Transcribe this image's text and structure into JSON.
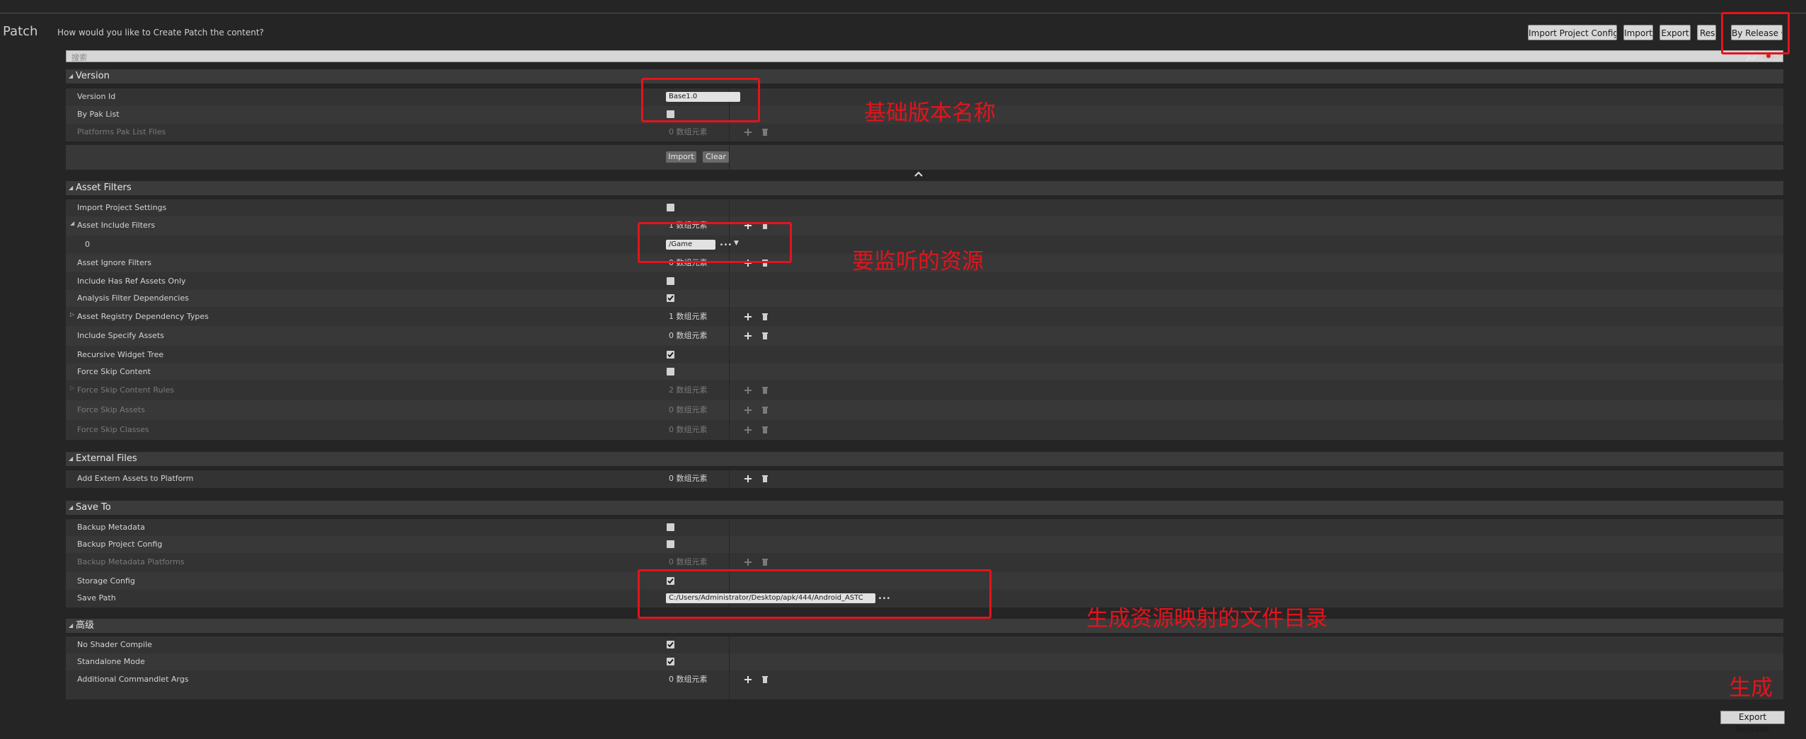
{
  "header": {
    "tab_title": "Patch",
    "question": "How would you like to Create Patch the content?",
    "buttons": {
      "import_project_config": "Import Project Config",
      "import": "Import",
      "export": "Export",
      "reset": "Reset",
      "by_release": "By Release"
    }
  },
  "search": {
    "placeholder": "搜索"
  },
  "version": {
    "title": "Version",
    "version_id_label": "Version Id",
    "version_id_value": "Base1.0",
    "by_pak_list_label": "By Pak List",
    "platforms_pak_list_label": "Platforms Pak List Files",
    "platforms_pak_list_value": "0 数组元素",
    "import_btn": "Import",
    "clear_btn": "Clear"
  },
  "asset_filters": {
    "title": "Asset Filters",
    "import_project_settings": "Import Project Settings",
    "asset_include_filters": "Asset Include Filters",
    "asset_include_filters_value": "1 数组元素",
    "include_index": "0",
    "include_value": "/Game",
    "asset_ignore_filters": "Asset Ignore Filters",
    "asset_ignore_filters_value": "0 数组元素",
    "include_has_ref": "Include Has Ref Assets Only",
    "analysis_filter": "Analysis Filter Dependencies",
    "registry_types": "Asset Registry Dependency Types",
    "registry_types_value": "1 数组元素",
    "include_specify": "Include Specify Assets",
    "include_specify_value": "0 数组元素",
    "recursive_widget": "Recursive Widget Tree",
    "force_skip_content": "Force Skip Content",
    "force_skip_rules": "Force Skip Content Rules",
    "force_skip_rules_value": "2 数组元素",
    "force_skip_assets": "Force Skip Assets",
    "force_skip_assets_value": "0 数组元素",
    "force_skip_classes": "Force Skip Classes",
    "force_skip_classes_value": "0 数组元素"
  },
  "external_files": {
    "title": "External Files",
    "add_extern": "Add Extern Assets to Platform",
    "add_extern_value": "0 数组元素"
  },
  "save_to": {
    "title": "Save To",
    "backup_metadata": "Backup Metadata",
    "backup_project_config": "Backup Project Config",
    "backup_metadata_platforms": "Backup Metadata Platforms",
    "backup_metadata_platforms_value": "0 数组元素",
    "storage_config": "Storage Config",
    "save_path": "Save Path",
    "save_path_value": "C:/Users/Administrator/Desktop/apk/444/Android_ASTC"
  },
  "advanced": {
    "title": "高级",
    "no_shader": "No Shader Compile",
    "standalone": "Standalone Mode",
    "additional_args": "Additional Commandlet Args",
    "additional_args_value": "0 数组元素"
  },
  "annotations": {
    "version_name": "基础版本名称",
    "watch_assets": "要监听的资源",
    "output_dir": "生成资源映射的文件目录",
    "generate": "生成"
  },
  "footer": {
    "export_release": "Export Release"
  },
  "colors": {
    "annotation_red": "#e3141c",
    "panel_bg": "#333333"
  }
}
